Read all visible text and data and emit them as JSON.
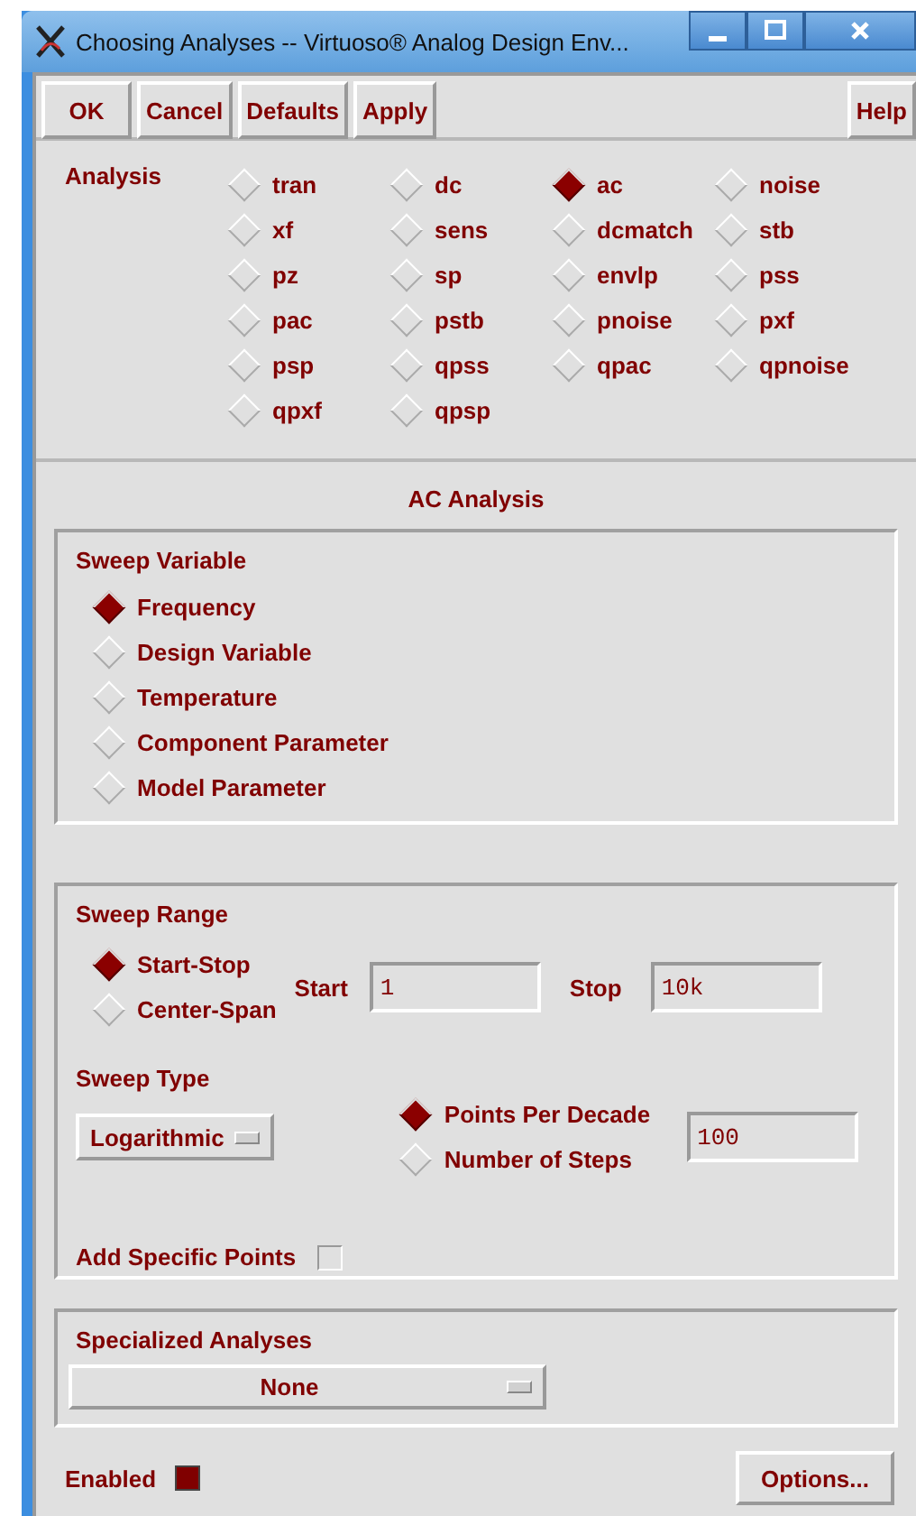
{
  "window": {
    "title": "Choosing Analyses -- Virtuoso® Analog Design Env..."
  },
  "buttons": [
    "OK",
    "Cancel",
    "Defaults",
    "Apply"
  ],
  "help_button": "Help",
  "analysis": {
    "label": "Analysis",
    "options": [
      {
        "label": "tran",
        "selected": false
      },
      {
        "label": "dc",
        "selected": false
      },
      {
        "label": "ac",
        "selected": true
      },
      {
        "label": "noise",
        "selected": false
      },
      {
        "label": "xf",
        "selected": false
      },
      {
        "label": "sens",
        "selected": false
      },
      {
        "label": "dcmatch",
        "selected": false
      },
      {
        "label": "stb",
        "selected": false
      },
      {
        "label": "pz",
        "selected": false
      },
      {
        "label": "sp",
        "selected": false
      },
      {
        "label": "envlp",
        "selected": false
      },
      {
        "label": "pss",
        "selected": false
      },
      {
        "label": "pac",
        "selected": false
      },
      {
        "label": "pstb",
        "selected": false
      },
      {
        "label": "pnoise",
        "selected": false
      },
      {
        "label": "pxf",
        "selected": false
      },
      {
        "label": "psp",
        "selected": false
      },
      {
        "label": "qpss",
        "selected": false
      },
      {
        "label": "qpac",
        "selected": false
      },
      {
        "label": "qpnoise",
        "selected": false
      },
      {
        "label": "qpxf",
        "selected": false
      },
      {
        "label": "qpsp",
        "selected": false
      }
    ]
  },
  "section_title": "AC Analysis",
  "sweep_variable": {
    "title": "Sweep Variable",
    "options": [
      {
        "label": "Frequency",
        "selected": true
      },
      {
        "label": "Design Variable",
        "selected": false
      },
      {
        "label": "Temperature",
        "selected": false
      },
      {
        "label": "Component Parameter",
        "selected": false
      },
      {
        "label": "Model Parameter",
        "selected": false
      }
    ]
  },
  "sweep_range": {
    "title": "Sweep Range",
    "options": [
      {
        "label": "Start-Stop",
        "selected": true
      },
      {
        "label": "Center-Span",
        "selected": false
      }
    ],
    "start": {
      "label": "Start",
      "value": "1"
    },
    "stop": {
      "label": "Stop",
      "value": "10k"
    }
  },
  "sweep_type": {
    "title": "Sweep Type",
    "dropdown": "Logarithmic",
    "options": [
      {
        "label": "Points Per Decade",
        "selected": true
      },
      {
        "label": "Number of Steps",
        "selected": false
      }
    ],
    "value": "100"
  },
  "add_specific_points": {
    "label": "Add Specific Points",
    "checked": false
  },
  "specialized_analyses": {
    "title": "Specialized Analyses",
    "dropdown": "None"
  },
  "enabled": {
    "label": "Enabled",
    "checked": true
  },
  "options_button": "Options..."
}
